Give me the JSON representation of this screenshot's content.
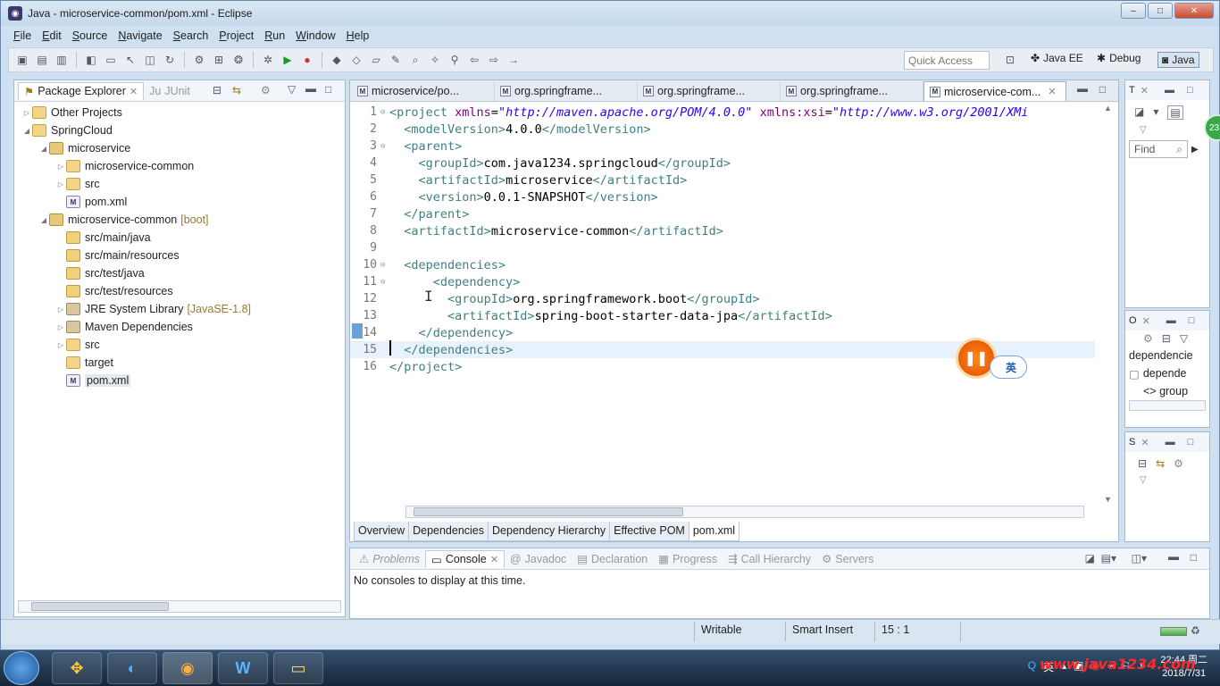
{
  "window": {
    "title": "Java - microservice-common/pom.xml - Eclipse",
    "controls": [
      "–",
      "□",
      "✕"
    ]
  },
  "menu": [
    "File",
    "Edit",
    "Source",
    "Navigate",
    "Search",
    "Project",
    "Run",
    "Window",
    "Help"
  ],
  "toolbar": {
    "quick_access_placeholder": "Quick Access",
    "perspectives": [
      "Java EE",
      "Debug",
      "Java"
    ]
  },
  "package_explorer": {
    "tab_label": "Package Explorer",
    "junit_label": "JUnit",
    "tree": [
      {
        "level": 0,
        "twisty": "▷",
        "icon": "folder",
        "label": "Other Projects",
        "decor": ""
      },
      {
        "level": 0,
        "twisty": "◢",
        "icon": "folder",
        "label": "SpringCloud",
        "decor": ""
      },
      {
        "level": 1,
        "twisty": "◢",
        "icon": "proj",
        "label": "microservice",
        "decor": ""
      },
      {
        "level": 2,
        "twisty": "▷",
        "icon": "folder",
        "label": "microservice-common",
        "decor": ""
      },
      {
        "level": 2,
        "twisty": "▷",
        "icon": "folder",
        "label": "src",
        "decor": ""
      },
      {
        "level": 2,
        "twisty": "",
        "icon": "xml",
        "label": "pom.xml",
        "decor": ""
      },
      {
        "level": 1,
        "twisty": "◢",
        "icon": "proj",
        "label": "microservice-common",
        "decor": "[boot]"
      },
      {
        "level": 2,
        "twisty": "",
        "icon": "pkgf",
        "label": "src/main/java",
        "decor": ""
      },
      {
        "level": 2,
        "twisty": "",
        "icon": "pkgf",
        "label": "src/main/resources",
        "decor": ""
      },
      {
        "level": 2,
        "twisty": "",
        "icon": "pkgf",
        "label": "src/test/java",
        "decor": ""
      },
      {
        "level": 2,
        "twisty": "",
        "icon": "pkgf",
        "label": "src/test/resources",
        "decor": ""
      },
      {
        "level": 2,
        "twisty": "▷",
        "icon": "jar",
        "label": "JRE System Library",
        "decor": "[JavaSE-1.8]"
      },
      {
        "level": 2,
        "twisty": "▷",
        "icon": "jar",
        "label": "Maven Dependencies",
        "decor": ""
      },
      {
        "level": 2,
        "twisty": "▷",
        "icon": "folder",
        "label": "src",
        "decor": ""
      },
      {
        "level": 2,
        "twisty": "",
        "icon": "folder",
        "label": "target",
        "decor": ""
      },
      {
        "level": 2,
        "twisty": "",
        "icon": "xml",
        "label": "pom.xml",
        "decor": "",
        "selected": true
      }
    ]
  },
  "editor": {
    "tabs": [
      {
        "label": "microservice/po...",
        "active": false
      },
      {
        "label": "org.springframe...",
        "active": false
      },
      {
        "label": "org.springframe...",
        "active": false
      },
      {
        "label": "org.springframe...",
        "active": false
      },
      {
        "label": "microservice-com...",
        "active": true
      }
    ],
    "lines": [
      {
        "n": "1",
        "fold": "⊖",
        "html": "<span class=\"t\">&lt;project</span> <span class=\"a\">xmlns</span>=<span class=\"v\">\"http://maven.apache.org/POM/4.0.0\"</span> <span class=\"a\">xmlns:xsi</span>=<span class=\"v\">\"http://www.w3.org/2001/XMi</span>"
      },
      {
        "n": "2",
        "fold": "",
        "html": "  <span class=\"t\">&lt;modelVersion&gt;</span>4.0.0<span class=\"t\">&lt;/modelVersion&gt;</span>"
      },
      {
        "n": "3",
        "fold": "⊖",
        "html": "  <span class=\"t\">&lt;parent&gt;</span>"
      },
      {
        "n": "4",
        "fold": "",
        "html": "    <span class=\"t\">&lt;groupId&gt;</span>com.java1234.springcloud<span class=\"t\">&lt;/groupId&gt;</span>"
      },
      {
        "n": "5",
        "fold": "",
        "html": "    <span class=\"t\">&lt;artifactId&gt;</span>microservice<span class=\"t\">&lt;/artifactId&gt;</span>"
      },
      {
        "n": "6",
        "fold": "",
        "html": "    <span class=\"t\">&lt;version&gt;</span>0.0.1-SNAPSHOT<span class=\"t\">&lt;/version&gt;</span>"
      },
      {
        "n": "7",
        "fold": "",
        "html": "  <span class=\"t\">&lt;/parent&gt;</span>"
      },
      {
        "n": "8",
        "fold": "",
        "html": "  <span class=\"t\">&lt;artifactId&gt;</span>microservice-common<span class=\"t\">&lt;/artifactId&gt;</span>"
      },
      {
        "n": "9",
        "fold": "",
        "html": ""
      },
      {
        "n": "10",
        "fold": "⊖",
        "html": "  <span class=\"t\">&lt;dependencies&gt;</span>"
      },
      {
        "n": "11",
        "fold": "⊖",
        "html": "      <span class=\"t\">&lt;dependency&gt;</span>"
      },
      {
        "n": "12",
        "fold": "",
        "html": "        <span class=\"t\">&lt;groupId&gt;</span>org.springframework.boot<span class=\"t\">&lt;/groupId&gt;</span>"
      },
      {
        "n": "13",
        "fold": "",
        "html": "        <span class=\"t\">&lt;artifactId&gt;</span>spring-boot-starter-data-jpa<span class=\"t\">&lt;/artifactId&gt;</span>"
      },
      {
        "n": "14",
        "fold": "",
        "html": "    <span class=\"t\">&lt;/dependency&gt;</span>"
      },
      {
        "n": "15",
        "fold": "",
        "html": "  <span class=\"t\">&lt;/dependencies&gt;</span>",
        "current": true
      },
      {
        "n": "16",
        "fold": "",
        "html": "<span class=\"t\">&lt;/project&gt;</span>"
      }
    ],
    "pom_tabs": [
      "Overview",
      "Dependencies",
      "Dependency Hierarchy",
      "Effective POM",
      "pom.xml"
    ]
  },
  "right_views": {
    "task_label": "T",
    "find_placeholder": "Find",
    "outline_label": "O",
    "outline_items": [
      "dependencie",
      "depende",
      "<> group"
    ],
    "s_label": "S"
  },
  "console": {
    "tabs": [
      "Problems",
      "Console",
      "Javadoc",
      "Declaration",
      "Progress",
      "Call Hierarchy",
      "Servers"
    ],
    "message": "No consoles to display at this time."
  },
  "status": {
    "writable": "Writable",
    "insert": "Smart Insert",
    "position": "15 : 1"
  },
  "overlay": {
    "ime": "英",
    "badge": "23"
  },
  "taskbar": {
    "tray_lang": "英",
    "watermark": "www.java1234.com",
    "time": "22:44 周二",
    "date": "2018/7/31"
  }
}
